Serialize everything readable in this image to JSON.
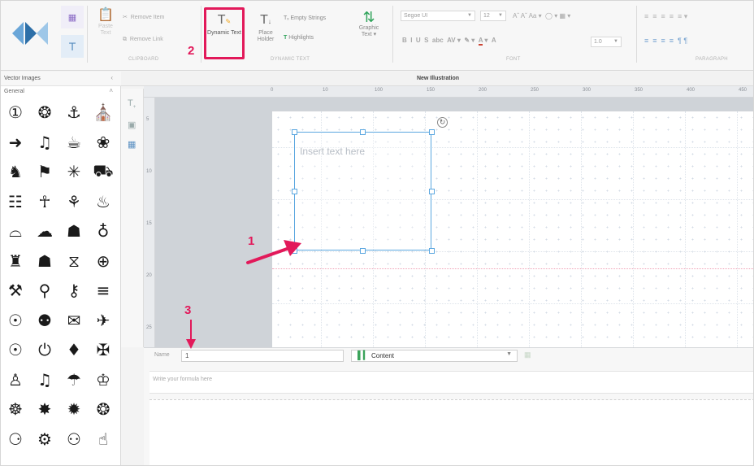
{
  "ribbon": {
    "clipboard_group": "CLIPBOARD",
    "dynamic_text_group": "DYNAMIC TEXT",
    "font_group": "FONT",
    "paragraph_group": "PARAGRAPH",
    "dynamic_text_button": "Dynamic Text",
    "place_holder_button": "Place Holder",
    "highlights_button": "Highlights",
    "empty_strings_button": "Tₓ Empty Strings",
    "graphic_text_button": "Graphic Text ▾",
    "font_name": "Segoe UI",
    "font_size": "12",
    "line_spacing": "1.0"
  },
  "left_panel": {
    "title": "Vector Images",
    "category": "General",
    "icons": [
      "clock-icon",
      "brain-icon",
      "anchor-icon",
      "bank-icon",
      "bird-icon",
      "bell-icon",
      "shopping-icon",
      "cake-icon",
      "camera-icon",
      "graduation-cap-icon",
      "molecule-icon",
      "truck-icon",
      "document-icon",
      "people-icon",
      "flowerpot-icon",
      "fire-icon",
      "dome-icon",
      "cloud-icon",
      "trophy-icon",
      "globe-icon",
      "chess-knight-icon",
      "building-icon",
      "hourglass-icon",
      "network-icon",
      "pin-icon",
      "key-icon",
      "wrench-icon",
      "layers-icon",
      "lightbulb-icon",
      "location-icon",
      "mail-icon",
      "airplane-icon",
      "dial-icon",
      "power-icon",
      "diamond-icon",
      "gift-icon",
      "bag-icon",
      "music-icon",
      "cloud-rain-icon",
      "crown-icon",
      "car-icon",
      "virus-icon",
      "sun-icon",
      "sun2-icon",
      "badge-icon",
      "gear-icon",
      "masks-icon",
      "thumbs-up-icon"
    ],
    "glyphs": [
      "①",
      "❂",
      "⚓",
      "⛪",
      "➜",
      "♫",
      "☕",
      "❀",
      "♞",
      "⚑",
      "✳",
      "⛟",
      "☷",
      "☥",
      "⚘",
      "♨",
      "⌓",
      "☁",
      "☗",
      "♁",
      "♜",
      "☗",
      "⧖",
      "⊕",
      "⚒",
      "⚲",
      "⚷",
      "≡",
      "☉",
      "⚉",
      "✉",
      "✈",
      "☉",
      "⏻",
      "♦",
      "✠",
      "♙",
      "♫",
      "☂",
      "♔",
      "☸",
      "✸",
      "✹",
      "❂",
      "⚆",
      "⚙",
      "⚇",
      "☝"
    ]
  },
  "canvas": {
    "title": "New Illustration",
    "textbox_placeholder": "Insert text here",
    "ruler_top": [
      "0",
      "10",
      "100",
      "150",
      "200",
      "250",
      "300",
      "350",
      "400",
      "450"
    ],
    "ruler_left": [
      "5",
      "10",
      "15",
      "20",
      "25"
    ]
  },
  "bottom": {
    "name_label": "Name",
    "name_value": "1",
    "content_label": "Content",
    "formula_placeholder": "Write your formula here"
  },
  "callouts": {
    "one": "1",
    "two": "2",
    "three": "3"
  },
  "colors": {
    "callout": "#e2195a",
    "selection": "#5ba7e0"
  }
}
